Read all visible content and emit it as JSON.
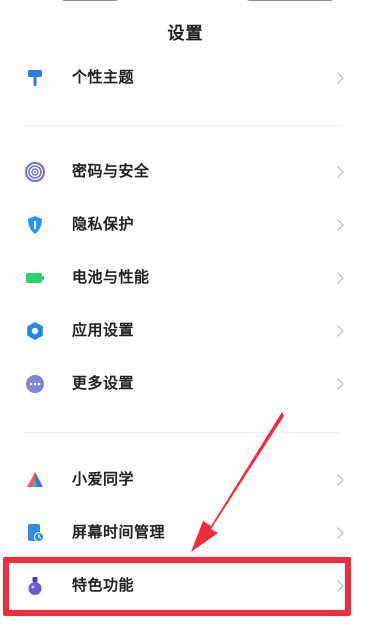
{
  "page": {
    "title": "设置"
  },
  "sections": [
    {
      "items": [
        {
          "label": "个性主题",
          "icon": "paint-roller-icon",
          "color": "#2a7de1"
        }
      ]
    },
    {
      "items": [
        {
          "label": "密码与安全",
          "icon": "fingerprint-icon",
          "color": "#6d74c9"
        },
        {
          "label": "隐私保护",
          "icon": "shield-icon",
          "color": "#2196f3"
        },
        {
          "label": "电池与性能",
          "icon": "battery-icon",
          "color": "#2fd169"
        },
        {
          "label": "应用设置",
          "icon": "gear-icon",
          "color": "#1e88e5"
        },
        {
          "label": "更多设置",
          "icon": "more-icon",
          "color": "#7c85d8"
        }
      ]
    },
    {
      "items": [
        {
          "label": "小爱同学",
          "icon": "xiaoai-icon",
          "color": "#5a7cff"
        },
        {
          "label": "屏幕时间管理",
          "icon": "screen-time-icon",
          "color": "#2f8de4"
        },
        {
          "label": "特色功能",
          "icon": "flask-icon",
          "color": "#6a5acd"
        }
      ]
    }
  ],
  "annotation": {
    "highlight_color": "#f02e3b",
    "arrow_color": "#f02e3b"
  }
}
